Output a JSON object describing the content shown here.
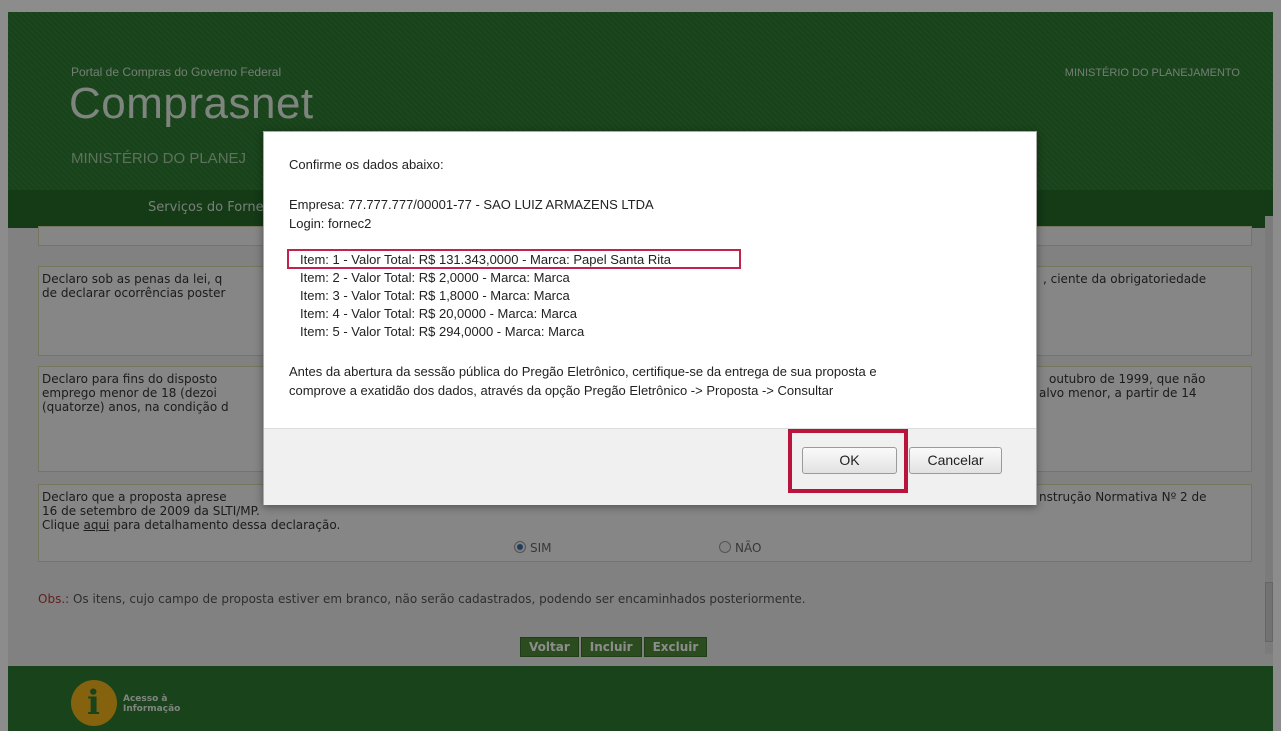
{
  "header": {
    "portal_name": "Portal de Compras do Governo Federal",
    "app_title": "Comprasnet",
    "ministry_sub": "MINISTÉRIO DO PLANEJ",
    "ministry_right": "MINISTÉRIO DO PLANEJAMENTO"
  },
  "nav": {
    "item": "Serviços do Forne"
  },
  "declarations": [
    {
      "line1": "Declaro sob as penas da lei, q",
      "line1_right": ", ciente da obrigatoriedade",
      "line2": "de declarar ocorrências poster"
    },
    {
      "line1": "Declaro para fins do disposto",
      "line1_right": "outubro de 1999, que não",
      "line2": "emprego menor de 18 (dezoi",
      "line2_right": "alvo menor, a partir de 14",
      "line3": "(quatorze) anos, na condição d"
    },
    {
      "line1": "Declaro que a proposta aprese",
      "line1_right": "nstrução Normativa Nº 2 de",
      "line2": "16 de setembro de 2009 da SLTI/MP.",
      "line3_pre": "Clique ",
      "line3_link": "aqui",
      "line3_post": " para detalhamento dessa declaração."
    }
  ],
  "radio": {
    "sim": "SIM",
    "nao": "NÃO",
    "selected": "SIM"
  },
  "obs": {
    "label": "Obs.:",
    "text": " Os itens, cujo campo de proposta estiver em branco, não serão cadastrados, podendo ser encaminhados posteriormente."
  },
  "buttons": {
    "voltar": "Voltar",
    "incluir": "Incluir",
    "excluir": "Excluir"
  },
  "footer": {
    "info_line1": "Acesso à",
    "info_line2": "Informação"
  },
  "dialog": {
    "heading": "Confirme os dados abaixo:",
    "empresa": "Empresa: 77.777.777/00001-77 - SAO LUIZ ARMAZENS LTDA",
    "login": "Login: fornec2",
    "items": [
      "Item: 1 - Valor Total: R$ 131.343,0000 - Marca: Papel Santa Rita",
      "Item: 2 - Valor Total: R$ 2,0000 - Marca: Marca",
      "Item: 3 - Valor Total: R$ 1,8000 - Marca: Marca",
      "Item: 4 - Valor Total: R$ 20,0000 - Marca: Marca",
      "Item: 5 - Valor Total: R$ 294,0000 - Marca: Marca"
    ],
    "note_line1": "Antes da abertura da sessão pública do Pregão Eletrônico, certifique-se da entrega de sua proposta e",
    "note_line2": "comprove a exatidão dos dados, através da opção Pregão Eletrônico -> Proposta -> Consultar",
    "ok_label": "OK",
    "cancel_label": "Cancelar"
  },
  "colors": {
    "brand_green": "#2e7d32",
    "highlight_red": "#c0234b"
  }
}
